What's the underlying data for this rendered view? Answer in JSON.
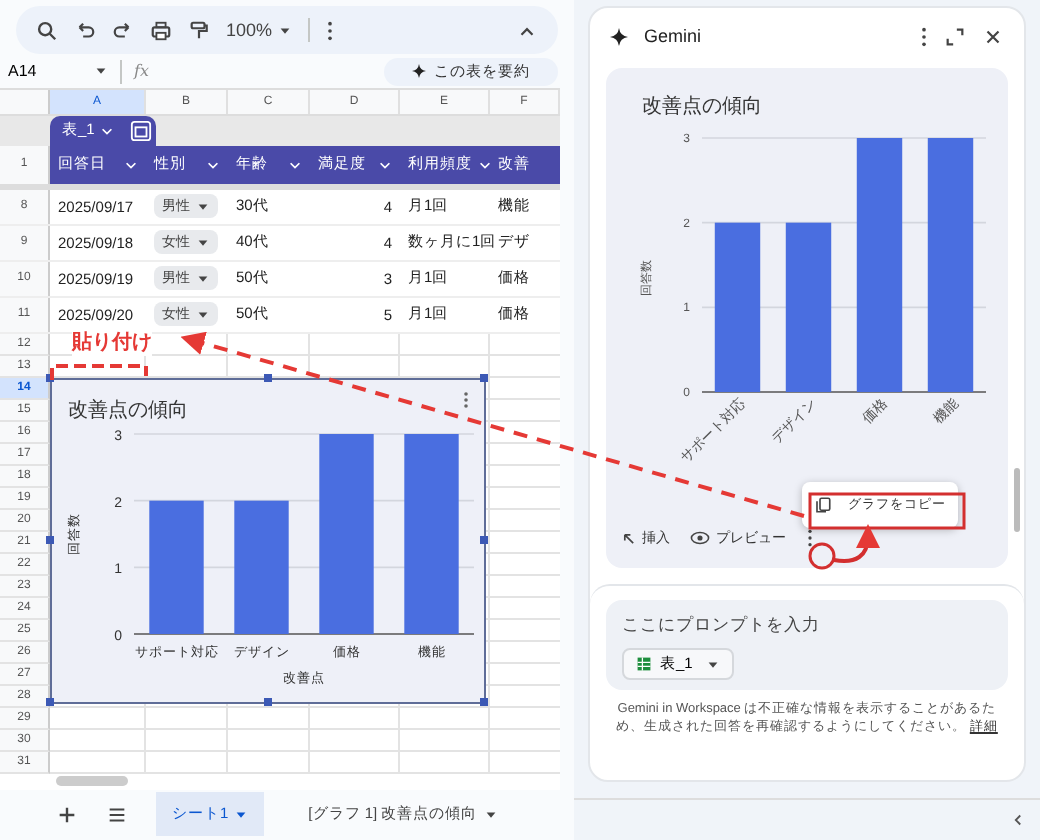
{
  "toolbar": {
    "zoom": "100%"
  },
  "formula_bar": {
    "name_box": "A14",
    "fx": "fx",
    "summarize_button": "この表を要約"
  },
  "columns": [
    {
      "label": "A",
      "selected": true
    },
    {
      "label": "B",
      "selected": false
    },
    {
      "label": "C",
      "selected": false
    },
    {
      "label": "D",
      "selected": false
    },
    {
      "label": "E",
      "selected": false
    },
    {
      "label": "F",
      "selected": false
    }
  ],
  "table": {
    "name": "表_1",
    "header_row": "1",
    "headers": [
      "回答日",
      "性別",
      "年齢",
      "満足度",
      "利用頻度",
      "改善"
    ],
    "rows": [
      {
        "row": "8",
        "date": "2025/09/17",
        "gender": "男性",
        "age": "30代",
        "satisfaction": "4",
        "frequency": "月1回",
        "improvement": "機能"
      },
      {
        "row": "9",
        "date": "2025/09/18",
        "gender": "女性",
        "age": "40代",
        "satisfaction": "4",
        "frequency": "数ヶ月に1回",
        "improvement": "デザ"
      },
      {
        "row": "10",
        "date": "2025/09/19",
        "gender": "男性",
        "age": "50代",
        "satisfaction": "3",
        "frequency": "月1回",
        "improvement": "価格"
      },
      {
        "row": "11",
        "date": "2025/09/20",
        "gender": "女性",
        "age": "50代",
        "satisfaction": "5",
        "frequency": "月1回",
        "improvement": "価格"
      }
    ]
  },
  "empty_rows": [
    {
      "row": "12",
      "selected": false
    },
    {
      "row": "13",
      "selected": false
    },
    {
      "row": "14",
      "selected": true
    },
    {
      "row": "15",
      "selected": false
    },
    {
      "row": "16",
      "selected": false
    },
    {
      "row": "17",
      "selected": false
    },
    {
      "row": "18",
      "selected": false
    },
    {
      "row": "19",
      "selected": false
    },
    {
      "row": "20",
      "selected": false
    },
    {
      "row": "21",
      "selected": false
    },
    {
      "row": "22",
      "selected": false
    },
    {
      "row": "23",
      "selected": false
    },
    {
      "row": "24",
      "selected": false
    },
    {
      "row": "25",
      "selected": false
    },
    {
      "row": "26",
      "selected": false
    },
    {
      "row": "27",
      "selected": false
    },
    {
      "row": "28",
      "selected": false
    },
    {
      "row": "29",
      "selected": false
    },
    {
      "row": "30",
      "selected": false
    },
    {
      "row": "31",
      "selected": false
    }
  ],
  "sheet_chart": {
    "chart_data": {
      "type": "bar",
      "title": "改善点の傾向",
      "xlabel": "改善点",
      "ylabel": "回答数",
      "categories": [
        "サポート対応",
        "デザイン",
        "価格",
        "機能"
      ],
      "values": [
        2,
        2,
        3,
        3
      ],
      "ylim": [
        0,
        3
      ],
      "yticks": [
        0,
        1,
        2,
        3
      ]
    }
  },
  "annotation": {
    "label": "貼り付け"
  },
  "sheet_tabs": [
    {
      "label": "シート1",
      "selected": true
    },
    {
      "label": "[グラフ 1] 改善点の傾向",
      "selected": false
    }
  ],
  "gemini": {
    "title": "Gemini",
    "chart_data": {
      "type": "bar",
      "title": "改善点の傾向",
      "ylabel": "回答数",
      "categories": [
        "サポート対応",
        "デザイン",
        "価格",
        "機能"
      ],
      "values": [
        2,
        2,
        3,
        3
      ],
      "ylim": [
        0,
        3
      ],
      "yticks": [
        0,
        1,
        2,
        3
      ]
    },
    "actions": [
      "挿入",
      "プレビュー"
    ],
    "menu_item": "グラフをコピー",
    "prompt": {
      "placeholder": "ここにプロンプトを入力",
      "chip": "表_1"
    },
    "disclaimer": "Gemini in Workspace は不正確な情報を表示することがあるため、生成された回答を再確認するようにしてください。",
    "disclaimer_link": "詳細"
  }
}
